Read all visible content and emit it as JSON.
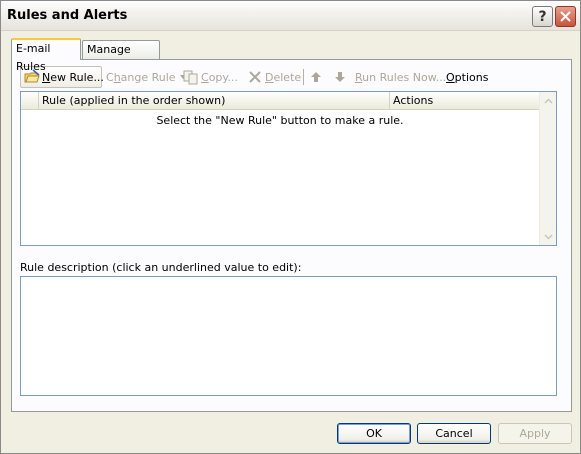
{
  "window": {
    "title": "Rules and Alerts",
    "help_glyph": "?",
    "close_glyph": "✕"
  },
  "tabs": [
    {
      "label": "E-mail Rules",
      "active": true
    },
    {
      "label": "Manage Alerts",
      "active": false
    }
  ],
  "toolbar": {
    "new_rule": {
      "underline": "N",
      "rest": "ew Rule...",
      "icon": "new-rule-icon"
    },
    "change_rule": {
      "prefix": "C",
      "underline": "h",
      "rest": "ange Rule",
      "icon": "dropdown-arrow-icon"
    },
    "copy": {
      "prefix": "",
      "underline": "C",
      "rest": "opy...",
      "icon": "copy-icon"
    },
    "delete": {
      "prefix": "",
      "underline": "D",
      "rest": "elete",
      "icon": "delete-icon"
    },
    "move_up_icon": "arrow-up-icon",
    "move_down_icon": "arrow-down-icon",
    "run_rules": {
      "underline": "R",
      "rest": "un Rules Now..."
    },
    "options": {
      "prefix": "",
      "underline": "O",
      "rest": "ptions"
    }
  },
  "rules_list": {
    "columns": [
      "Rule (applied in the order shown)",
      "Actions"
    ],
    "empty_message": "Select the \"New Rule\" button to make a rule."
  },
  "description": {
    "label": "Rule description (click an underlined value to edit):",
    "text": ""
  },
  "buttons": {
    "ok": "OK",
    "cancel": "Cancel",
    "apply": "Apply"
  },
  "colors": {
    "tab_accent": "#FFC83C",
    "list_border": "#7F9DB9",
    "button_border": "#003C74",
    "close_button": "#C8533A",
    "disabled_text": "#ACA899"
  }
}
